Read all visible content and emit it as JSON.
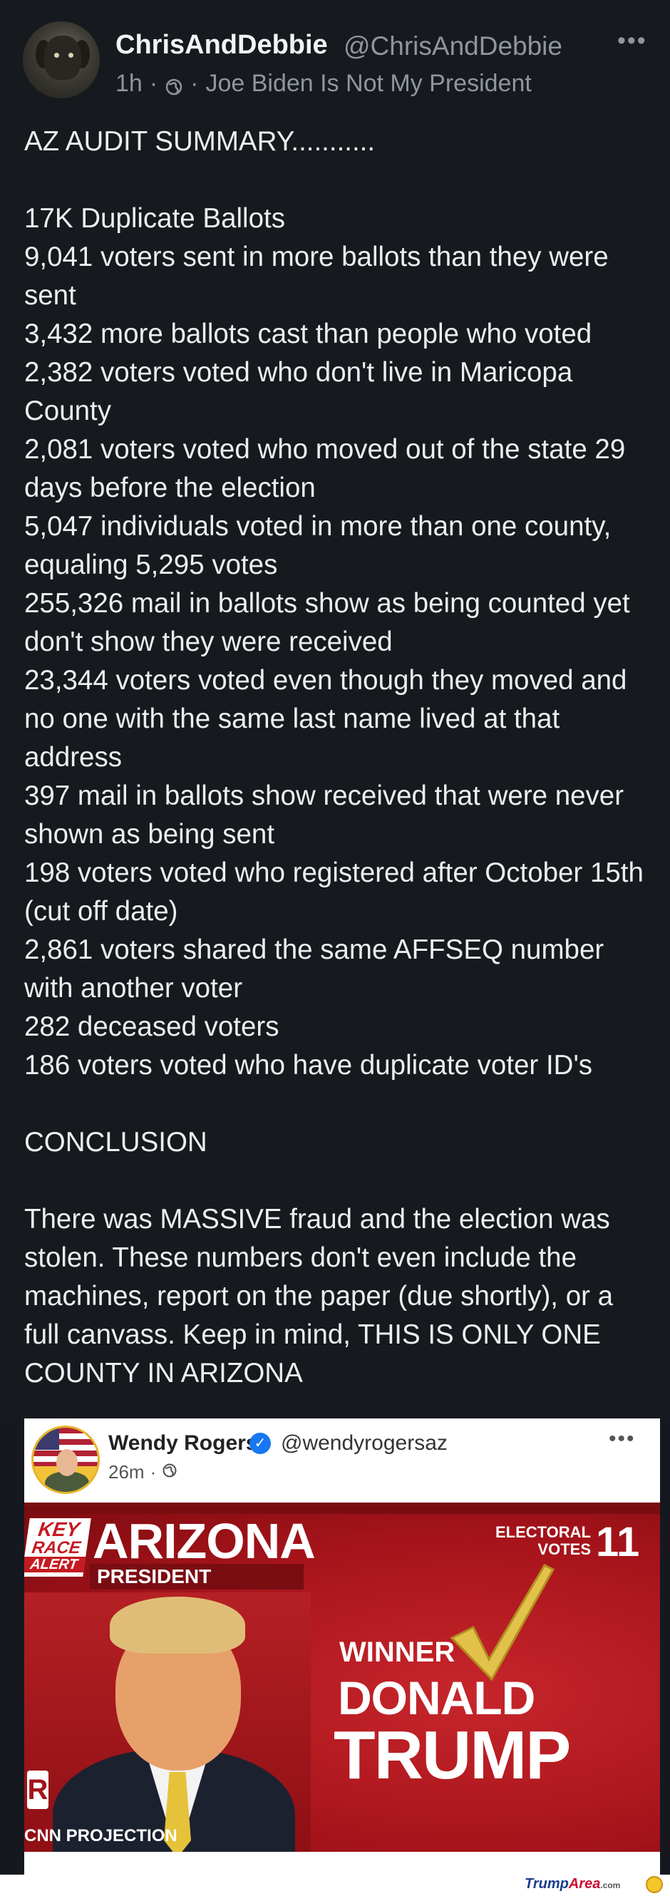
{
  "post": {
    "author": {
      "display_name": "ChrisAndDebbie",
      "handle": "@ChrisAndDebbie",
      "time": "1h",
      "separator": "·",
      "status": "Joe Biden Is Not My President"
    },
    "more_label": "•••",
    "paragraphs": [
      "AZ AUDIT SUMMARY...........",
      "17K Duplicate Ballots\n9,041 voters sent in more ballots than they were sent\n3,432 more ballots cast than people who voted\n2,382 voters voted who don't live in Maricopa County\n2,081 voters voted who moved out of the state 29 days before the election\n5,047 individuals voted in more than one county, equaling 5,295 votes\n255,326 mail in ballots show as being counted yet don't show they were received\n23,344 voters voted even though they moved and no one with the same last name lived at that address\n397 mail in ballots show received that were never shown as being sent\n198 voters voted who registered after October 15th (cut off date)\n2,861 voters shared the same AFFSEQ number with another voter\n282 deceased voters\n186 voters voted who have duplicate voter ID's",
      "CONCLUSION",
      "There was MASSIVE fraud and the election was stolen. These numbers don't even include the machines, report on the paper (due shortly), or a full canvass. Keep in mind, THIS IS ONLY ONE COUNTY IN ARIZONA"
    ]
  },
  "embed": {
    "author": {
      "display_name": "Wendy Rogers",
      "handle": "@wendyrogersaz",
      "time": "26m",
      "separator": "·"
    },
    "more_label": "•••",
    "graphic": {
      "badge_line1": "KEY",
      "badge_line2": "RACE",
      "badge_line3": "ALERT",
      "state": "ARIZONA",
      "race": "PRESIDENT",
      "electoral_label_1": "ELECTORAL",
      "electoral_label_2": "VOTES",
      "electoral_votes": "11",
      "winner_label": "WINNER",
      "winner_first": "DONALD",
      "winner_last": "TRUMP",
      "logo_letter": "R",
      "projection_text": "CNN PROJECTION"
    }
  },
  "watermark": {
    "brand_a": "Trump",
    "brand_b": "Area",
    "tld": ".com"
  },
  "colors": {
    "background": "#16191e",
    "text": "#eceef0",
    "muted": "#8f969e",
    "cnn_red": "#a8141b",
    "verified": "#1877f2"
  }
}
